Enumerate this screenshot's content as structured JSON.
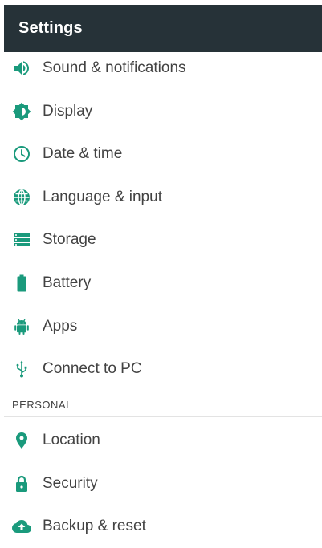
{
  "appbar": {
    "title": "Settings"
  },
  "accent_color": "#1a9a7c",
  "items_device": [
    {
      "label": "Sound & notifications",
      "icon": "volume-icon"
    },
    {
      "label": "Display",
      "icon": "brightness-icon"
    },
    {
      "label": "Date & time",
      "icon": "clock-icon"
    },
    {
      "label": "Language & input",
      "icon": "globe-icon"
    },
    {
      "label": "Storage",
      "icon": "storage-icon"
    },
    {
      "label": "Battery",
      "icon": "battery-icon"
    },
    {
      "label": "Apps",
      "icon": "android-icon"
    },
    {
      "label": "Connect to PC",
      "icon": "usb-icon"
    }
  ],
  "section_personal": {
    "header": "PERSONAL"
  },
  "items_personal": [
    {
      "label": "Location",
      "icon": "location-pin-icon"
    },
    {
      "label": "Security",
      "icon": "lock-icon"
    },
    {
      "label": "Backup & reset",
      "icon": "cloud-upload-icon"
    }
  ]
}
